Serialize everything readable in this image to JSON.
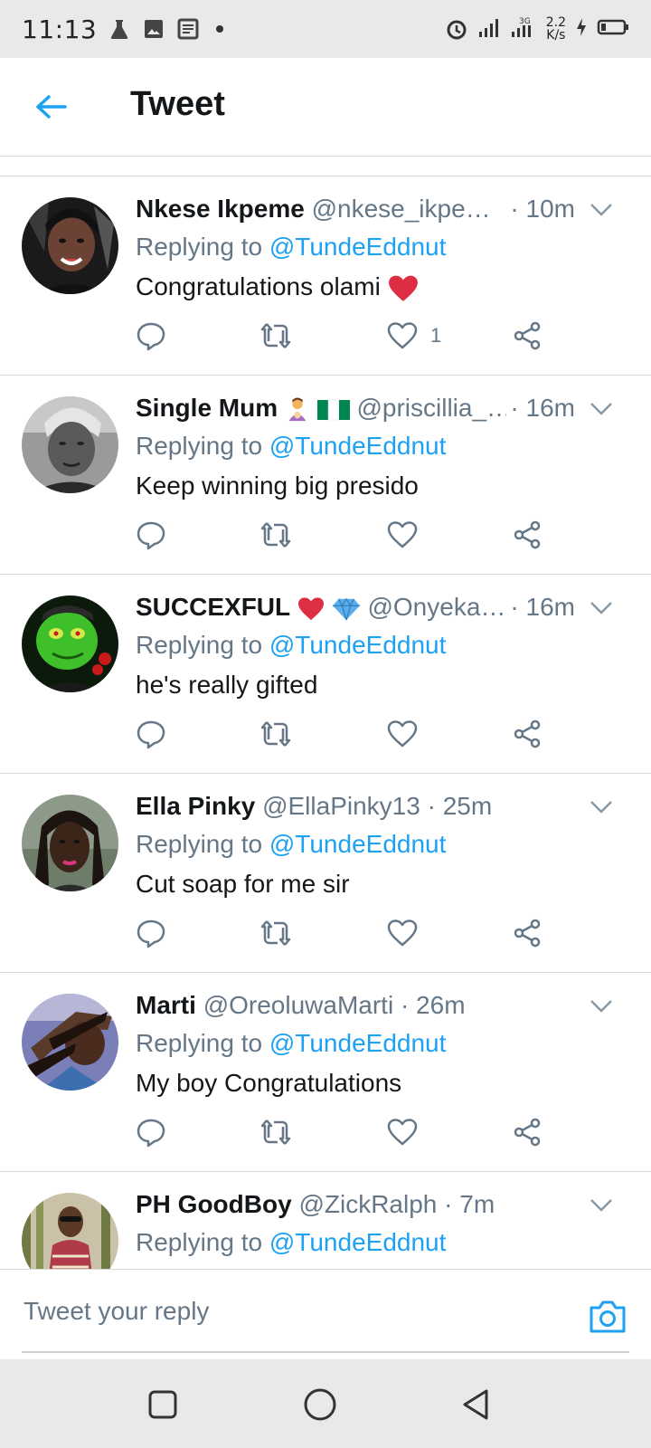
{
  "status_bar": {
    "time": "11:13",
    "speed_value": "2.2",
    "speed_unit": "K/s",
    "network": "3G",
    "icons": [
      "flask-icon",
      "image-icon",
      "news-icon",
      "dot-icon",
      "alarm-icon",
      "signal-icon",
      "signal-3g-icon",
      "charging-icon",
      "battery-icon"
    ]
  },
  "header": {
    "title": "Tweet",
    "back_icon": "arrow-left-icon"
  },
  "colors": {
    "accent": "#1da1f2",
    "secondary_text": "#657786",
    "primary_text": "#14171a",
    "divider": "#d8d8d8",
    "system_bar": "#e9e9e9"
  },
  "replies": [
    {
      "name": "Nkese Ikpeme",
      "handle": "@nkese_ikpe…",
      "time": "· 10m",
      "replying_prefix": "Replying to ",
      "replying_to": "@TundeEddnut",
      "text": "Congratulations olami",
      "text_emoji": "heart",
      "like_count": "1"
    },
    {
      "name": "Single Mum",
      "name_emojis": [
        "mother-with-baby",
        "nigeria-flag"
      ],
      "handle": "@priscillia_…",
      "time": "· 16m",
      "replying_prefix": "Replying to ",
      "replying_to": "@TundeEddnut",
      "text": "Keep winning big presido",
      "like_count": ""
    },
    {
      "name": "SUCCEXFUL",
      "name_emojis": [
        "heart",
        "gem"
      ],
      "handle": "@Onyeka…",
      "time": "· 16m",
      "replying_prefix": "Replying to ",
      "replying_to": "@TundeEddnut",
      "text": "he's really gifted",
      "like_count": ""
    },
    {
      "name": "Ella Pinky",
      "handle": "@EllaPinky13",
      "time": "· 25m",
      "replying_prefix": "Replying to ",
      "replying_to": "@TundeEddnut",
      "text": "Cut soap for me sir",
      "like_count": ""
    },
    {
      "name": "Marti",
      "handle": "@OreoluwaMarti",
      "time": "· 26m",
      "replying_prefix": "Replying to ",
      "replying_to": "@TundeEddnut",
      "text": "My boy Congratulations",
      "like_count": ""
    },
    {
      "name": "PH GoodBoy",
      "handle": "@ZickRalph",
      "time": "· 7m",
      "replying_prefix": "Replying to ",
      "replying_to": "@TundeEddnut",
      "text": "",
      "like_count": ""
    }
  ],
  "action_icons": [
    "reply-icon",
    "retweet-icon",
    "like-icon",
    "share-icon"
  ],
  "reply_bar": {
    "placeholder": "Tweet your reply",
    "camera_icon": "camera-icon"
  },
  "nav_bar": {
    "buttons": [
      "recents-square-icon",
      "home-circle-icon",
      "back-triangle-icon"
    ]
  }
}
